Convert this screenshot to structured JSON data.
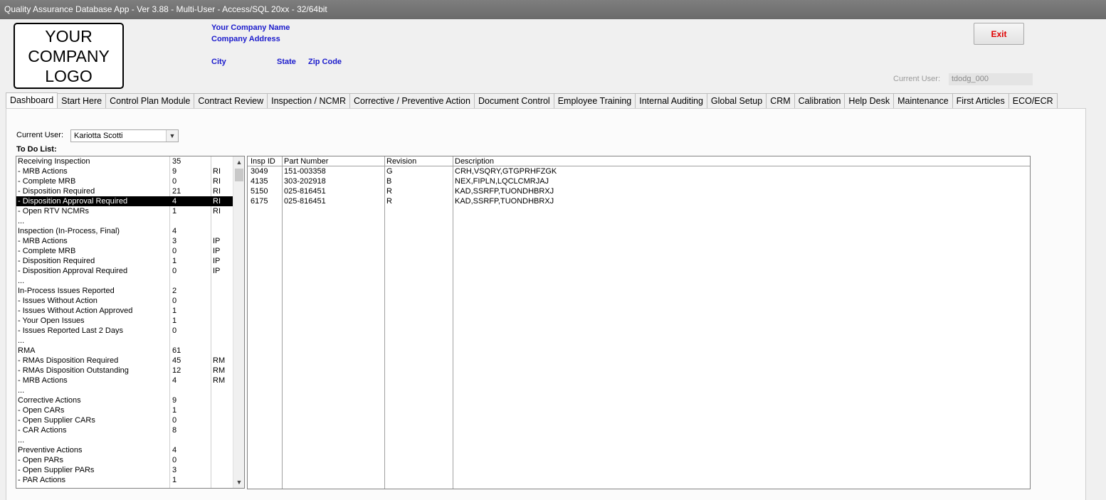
{
  "window": {
    "title": "Quality Assurance Database App - Ver 3.88 - Multi-User - Access/SQL 20xx - 32/64bit"
  },
  "logo": {
    "line1": "YOUR",
    "line2": "COMPANY",
    "line3": "LOGO"
  },
  "company": {
    "name": "Your Company Name",
    "address": "Company Address",
    "city": "City",
    "state": "State",
    "zip": "Zip Code"
  },
  "header": {
    "exit_label": "Exit",
    "current_user_label": "Current User:",
    "current_user_value": "tdodg_000"
  },
  "tabs": [
    "Dashboard",
    "Start Here",
    "Control Plan Module",
    "Contract Review",
    "Inspection / NCMR",
    "Corrective / Preventive Action",
    "Document Control",
    "Employee Training",
    "Internal Auditing",
    "Global Setup",
    "CRM",
    "Calibration",
    "Help Desk",
    "Maintenance",
    "First Articles",
    "ECO/ECR"
  ],
  "dashboard": {
    "current_user_label": "Current User:",
    "current_user_selected": "Kariotta Scotti",
    "todo_label": "To Do List:",
    "todo_items": [
      {
        "label": "Receiving Inspection",
        "count": "35",
        "code": ""
      },
      {
        "label": " - MRB Actions",
        "count": "9",
        "code": "RI"
      },
      {
        "label": " - Complete MRB",
        "count": "0",
        "code": "RI"
      },
      {
        "label": " - Disposition Required",
        "count": "21",
        "code": "RI"
      },
      {
        "label": " - Disposition Approval Required",
        "count": "4",
        "code": "RI"
      },
      {
        "label": " - Open RTV NCMRs",
        "count": "1",
        "code": "RI"
      },
      {
        "label": "...",
        "count": "",
        "code": ""
      },
      {
        "label": "Inspection (In-Process, Final)",
        "count": "4",
        "code": ""
      },
      {
        "label": " - MRB Actions",
        "count": "3",
        "code": "IP"
      },
      {
        "label": " - Complete MRB",
        "count": "0",
        "code": "IP"
      },
      {
        "label": " - Disposition Required",
        "count": "1",
        "code": "IP"
      },
      {
        "label": " - Disposition Approval Required",
        "count": "0",
        "code": "IP"
      },
      {
        "label": "...",
        "count": "",
        "code": ""
      },
      {
        "label": "In-Process Issues Reported",
        "count": "2",
        "code": ""
      },
      {
        "label": " - Issues Without Action",
        "count": "0",
        "code": ""
      },
      {
        "label": " - Issues Without Action Approved",
        "count": "1",
        "code": ""
      },
      {
        "label": " - Your Open Issues",
        "count": "1",
        "code": ""
      },
      {
        "label": " - Issues Reported Last 2 Days",
        "count": "0",
        "code": ""
      },
      {
        "label": "...",
        "count": "",
        "code": ""
      },
      {
        "label": "RMA",
        "count": "61",
        "code": ""
      },
      {
        "label": " - RMAs Disposition Required",
        "count": "45",
        "code": "RM"
      },
      {
        "label": " - RMAs Disposition Outstanding",
        "count": "12",
        "code": "RM"
      },
      {
        "label": " - MRB Actions",
        "count": "4",
        "code": "RM"
      },
      {
        "label": "...",
        "count": "",
        "code": ""
      },
      {
        "label": "Corrective Actions",
        "count": "9",
        "code": ""
      },
      {
        "label": " - Open CARs",
        "count": "1",
        "code": ""
      },
      {
        "label": " - Open Supplier CARs",
        "count": "0",
        "code": ""
      },
      {
        "label": " - CAR Actions",
        "count": "8",
        "code": ""
      },
      {
        "label": "...",
        "count": "",
        "code": ""
      },
      {
        "label": "Preventive Actions",
        "count": "4",
        "code": ""
      },
      {
        "label": " - Open PARs",
        "count": "0",
        "code": ""
      },
      {
        "label": " - Open Supplier PARs",
        "count": "3",
        "code": ""
      },
      {
        "label": " - PAR Actions",
        "count": "1",
        "code": ""
      }
    ],
    "selected_index": 4,
    "inspections": {
      "columns": [
        "Insp ID",
        "Part Number",
        "Revision",
        "Description"
      ],
      "rows": [
        [
          "3049",
          "151-003358",
          "G",
          "CRH,VSQRY,GTGPRHFZGK"
        ],
        [
          "4135",
          "303-202918",
          "B",
          "NEX,FIPLN,LQCLCMRJAJ"
        ],
        [
          "5150",
          "025-816451",
          "R",
          "KAD,SSRFP,TUONDHBRXJ"
        ],
        [
          "6175",
          "025-816451",
          "R",
          "KAD,SSRFP,TUONDHBRXJ"
        ]
      ]
    }
  }
}
